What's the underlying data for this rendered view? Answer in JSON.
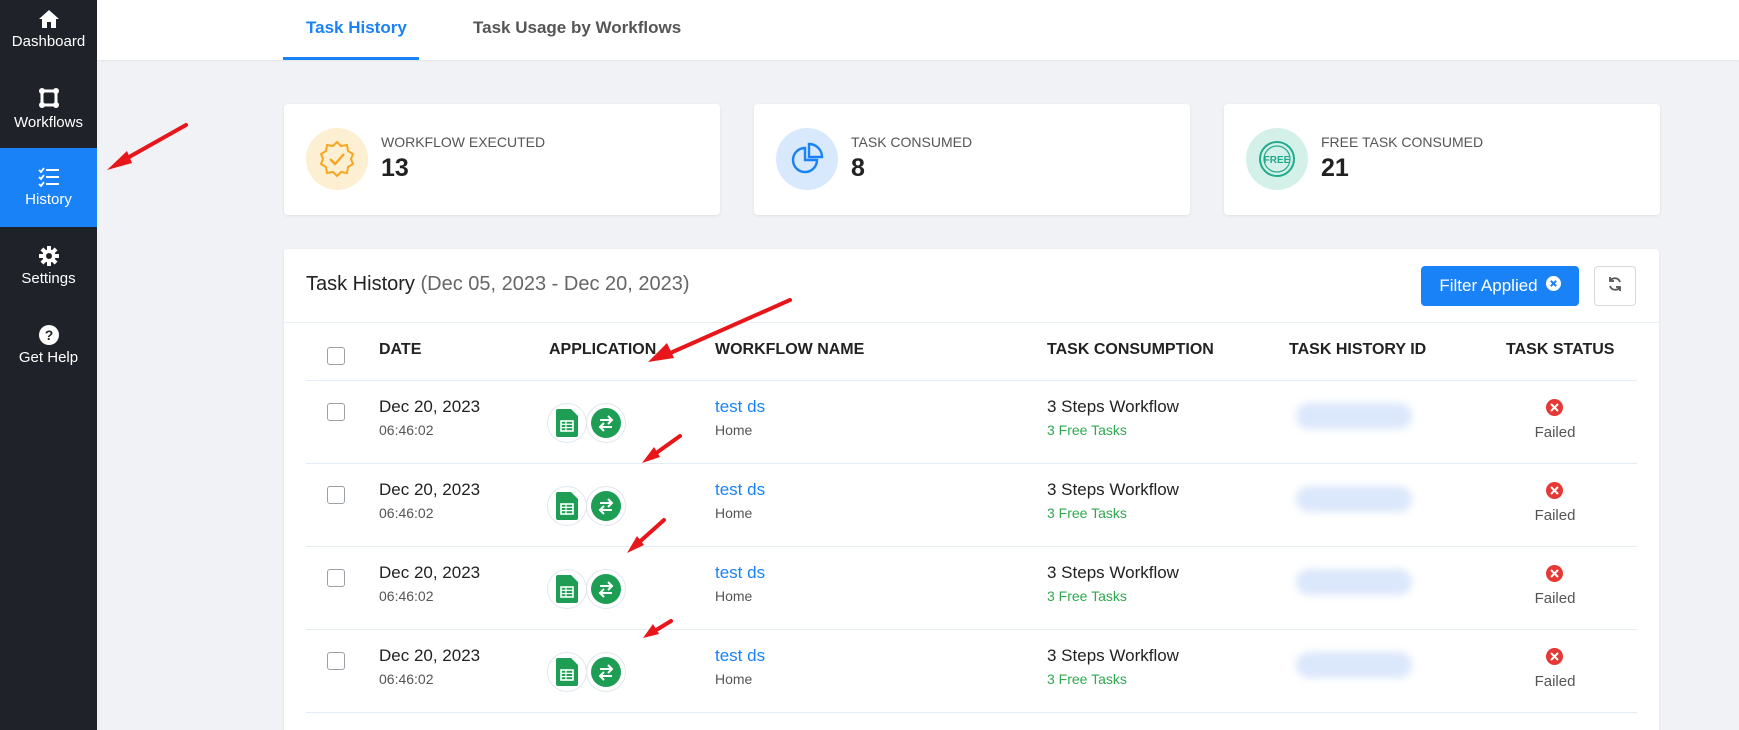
{
  "sidebar": {
    "items": [
      {
        "label": "Dashboard",
        "icon": "home-icon"
      },
      {
        "label": "Workflows",
        "icon": "workflow-icon"
      },
      {
        "label": "History",
        "icon": "history-list-icon",
        "active": true
      },
      {
        "label": "Settings",
        "icon": "gear-icon"
      },
      {
        "label": "Get Help",
        "icon": "help-icon"
      }
    ]
  },
  "tabs": [
    {
      "label": "Task History",
      "active": true
    },
    {
      "label": "Task Usage by Workflows",
      "active": false
    }
  ],
  "stats": [
    {
      "label": "WORKFLOW EXECUTED",
      "value": "13",
      "icon": "badge-check-icon",
      "color": "#f5a623"
    },
    {
      "label": "TASK CONSUMED",
      "value": "8",
      "icon": "pie-chart-icon",
      "color": "#1a82f7"
    },
    {
      "label": "FREE TASK CONSUMED",
      "value": "21",
      "icon": "free-badge-icon",
      "color": "#23a98c"
    }
  ],
  "history": {
    "title": "Task History",
    "range": "(Dec 05, 2023 - Dec 20, 2023)",
    "filter_label": "Filter Applied",
    "columns": [
      "DATE",
      "APPLICATION",
      "WORKFLOW NAME",
      "TASK CONSUMPTION",
      "TASK HISTORY ID",
      "TASK STATUS"
    ],
    "rows": [
      {
        "date": "Dec 20, 2023",
        "time": "06:46:02",
        "workflow": "test ds",
        "folder": "Home",
        "consumption": "3 Steps Workflow",
        "free": "3 Free Tasks",
        "status": "Failed"
      },
      {
        "date": "Dec 20, 2023",
        "time": "06:46:02",
        "workflow": "test ds",
        "folder": "Home",
        "consumption": "3 Steps Workflow",
        "free": "3 Free Tasks",
        "status": "Failed"
      },
      {
        "date": "Dec 20, 2023",
        "time": "06:46:02",
        "workflow": "test ds",
        "folder": "Home",
        "consumption": "3 Steps Workflow",
        "free": "3 Free Tasks",
        "status": "Failed"
      },
      {
        "date": "Dec 20, 2023",
        "time": "06:46:02",
        "workflow": "test ds",
        "folder": "Home",
        "consumption": "3 Steps Workflow",
        "free": "3 Free Tasks",
        "status": "Failed"
      }
    ]
  },
  "colors": {
    "accent": "#1a82f7",
    "sidebar": "#1f2329",
    "failed": "#e53935",
    "free_tasks": "#2fa84f",
    "annotation_arrow": "#e8161b"
  }
}
